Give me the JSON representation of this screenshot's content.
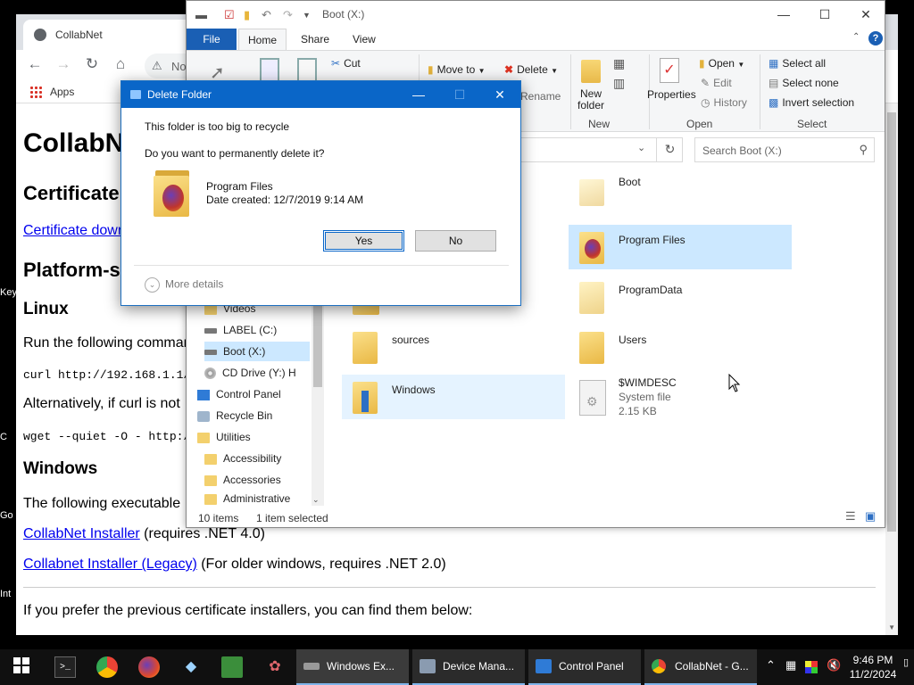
{
  "desktop": {
    "edge_labels": [
      "Key",
      "C",
      "Go",
      "Int"
    ]
  },
  "chrome": {
    "tab_title": "CollabNet",
    "omnibox_text": "No",
    "bookmarks_apps": "Apps",
    "page": {
      "h1": "CollabN",
      "h2_certificate": "Certificate",
      "cert_link": "Certificate dowr",
      "h2_platform": "Platform-s",
      "h3_linux": "Linux",
      "linux_text": "Run the following comman",
      "curl_cmd": "curl http://192.168.1.1/se",
      "alt_text": "Alternatively, if curl is not",
      "wget_cmd": "wget --quiet -O - http://1",
      "h3_windows": "Windows",
      "win_text": "The following executable",
      "installer_link": "CollabNet Installer",
      "installer_req": " (requires .NET 4.0)",
      "legacy_link": "Collabnet Installer (Legacy)",
      "legacy_req": " (For older windows, requires .NET 2.0)",
      "prev_text": "If you prefer the previous certificate installers, you can find them below:"
    }
  },
  "explorer": {
    "title": "Boot (X:)",
    "tabs": {
      "file": "File",
      "home": "Home",
      "share": "Share",
      "view": "View"
    },
    "ribbon": {
      "cut": "Cut",
      "move_to": "Move to",
      "delete": "Delete",
      "rename": "Rename",
      "new_folder": "New\nfolder",
      "new_folder_l1": "New",
      "new_folder_l2": "folder",
      "properties": "Properties",
      "open": "Open",
      "edit": "Edit",
      "history": "History",
      "select_all": "Select all",
      "select_none": "Select none",
      "invert_selection": "Invert selection",
      "group_new": "New",
      "group_open": "Open",
      "group_select": "Select"
    },
    "search_placeholder": "Search Boot (X:)",
    "nav": [
      {
        "label": "Videos",
        "icon": "folder"
      },
      {
        "label": "LABEL (C:)",
        "icon": "drive"
      },
      {
        "label": "Boot (X:)",
        "icon": "drive"
      },
      {
        "label": "CD Drive (Y:) H",
        "icon": "cd"
      },
      {
        "label": "Control Panel",
        "icon": "cpanel"
      },
      {
        "label": "Recycle Bin",
        "icon": "bin"
      },
      {
        "label": "Utilities",
        "icon": "folder"
      },
      {
        "label": "Accessibility",
        "icon": "folder"
      },
      {
        "label": "Accessories",
        "icon": "folder"
      },
      {
        "label": "Administrative",
        "icon": "folder"
      }
    ],
    "items": [
      {
        "name": "Boot"
      },
      {
        "name": "Program Files"
      },
      {
        "name": "ProgramData"
      },
      {
        "name": "sources"
      },
      {
        "name": "Users"
      },
      {
        "name": "Windows"
      },
      {
        "name": "$WIMDESC",
        "type": "System file",
        "size": "2.15 KB"
      }
    ],
    "status": {
      "count": "10 items",
      "selected": "1 item selected"
    }
  },
  "dialog": {
    "title": "Delete Folder",
    "line1": "This folder is too big to recycle",
    "line2": "Do you want to permanently delete it?",
    "item_name": "Program Files",
    "item_date": "Date created: 12/7/2019 9:14 AM",
    "yes": "Yes",
    "no": "No",
    "more_details": "More details"
  },
  "taskbar": {
    "apps": [
      {
        "label": "Windows Ex...",
        "active": true
      },
      {
        "label": "Device Mana...",
        "active": false
      },
      {
        "label": "Control Panel",
        "active": false
      },
      {
        "label": "CollabNet - G...",
        "active": false
      }
    ],
    "time": "9:46 PM",
    "date": "11/2/2024"
  },
  "colors": {
    "accent": "#0a66c8",
    "selection": "#cce8ff",
    "link": "#0000ee",
    "taskbar": "#101010"
  }
}
